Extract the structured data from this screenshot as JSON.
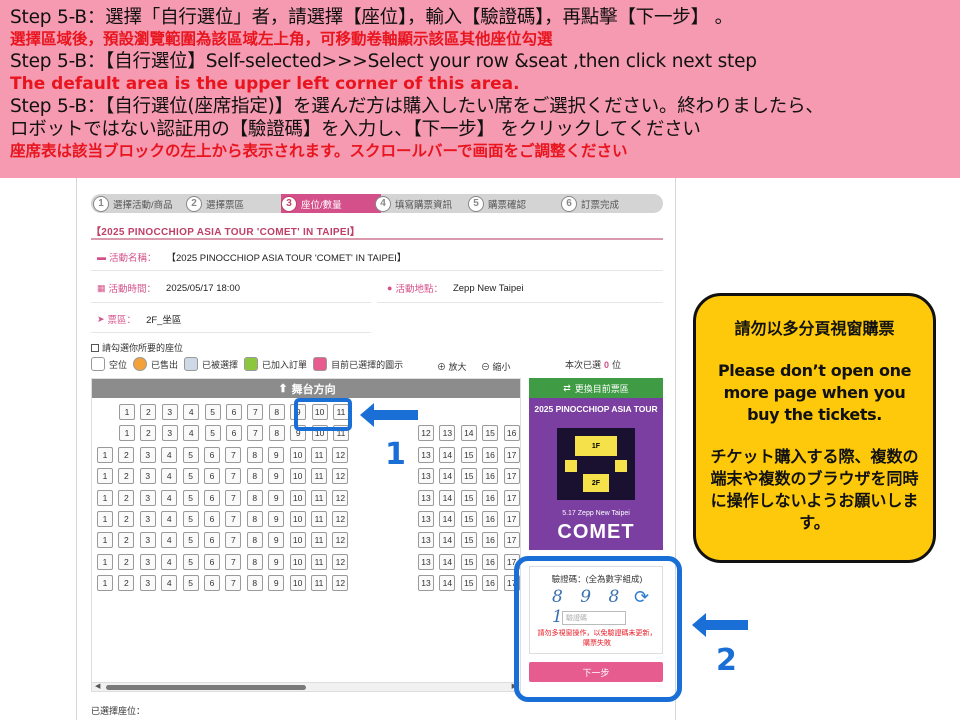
{
  "banner": {
    "line1": "Step 5-B：選擇「自行選位」者，請選擇【座位】，輸入【驗證碼】，再點擊【下一步】 。",
    "line2": "選擇區域後，預設瀏覽範圍為該區域左上角，可移動卷軸顯示該區其他座位勾選",
    "line3": "Step 5-B：【自行選位】Self-selected>>>Select   your row &seat ,then click  next step",
    "line4": "The default area is the upper left corner of this area.",
    "line5": "Step 5-B：【自行選位(座席指定)】を選んだ方は購入したい席をご選択ください。終わりましたら、",
    "line6": "ロボットではない認証用の【驗證碼】を入力し、【下一步】 をクリックしてください",
    "line7": "座席表は該当ブロックの左上から表示されます。スクロールバーで画面をご調整ください"
  },
  "steps": [
    {
      "num": "1",
      "label": "選擇活動/商品"
    },
    {
      "num": "2",
      "label": "選擇票區"
    },
    {
      "num": "3",
      "label": "座位/數量"
    },
    {
      "num": "4",
      "label": "填寫購票資訊"
    },
    {
      "num": "5",
      "label": "購票確認"
    },
    {
      "num": "6",
      "label": "訂票完成"
    }
  ],
  "event": {
    "title": "【2025 PINOCCHIOP ASIA TOUR 'COMET' IN TAIPEI】",
    "name_label": "活動名稱：",
    "name_value": "【2025 PINOCCHIOP ASIA TOUR 'COMET' IN TAIPEI】",
    "time_label": "活動時間：",
    "time_value": "2025/05/17 18:00",
    "venue_label": "活動地點：",
    "venue_value": "Zepp New Taipei",
    "area_label": "票區：",
    "area_value": "2F_坐區"
  },
  "seat_ui": {
    "check_label": "請勾選你所要的座位",
    "legend": [
      "空位",
      "已售出",
      "已被選擇",
      "已加入訂單",
      "目前已選擇的圖示"
    ],
    "zoom_in": "放大",
    "zoom_out": "縮小",
    "count_prefix": "本次已選",
    "count_value": "0",
    "count_suffix": "位",
    "stage": "舞台方向",
    "change_area": "更換目前票區",
    "selected_label": "已選擇座位："
  },
  "seat_rows": [
    {
      "left": [
        "1",
        "2",
        "3",
        "4",
        "5",
        "6",
        "7",
        "8",
        "9",
        "10",
        "11"
      ],
      "right": []
    },
    {
      "left": [
        "1",
        "2",
        "3",
        "4",
        "5",
        "6",
        "7",
        "8",
        "9",
        "10",
        "11"
      ],
      "right": [
        "12",
        "13",
        "14",
        "15",
        "16"
      ]
    },
    {
      "left": [
        "1",
        "2",
        "3",
        "4",
        "5",
        "6",
        "7",
        "8",
        "9",
        "10",
        "11",
        "12"
      ],
      "right": [
        "13",
        "14",
        "15",
        "16",
        "17"
      ]
    },
    {
      "left": [
        "1",
        "2",
        "3",
        "4",
        "5",
        "6",
        "7",
        "8",
        "9",
        "10",
        "11",
        "12"
      ],
      "right": [
        "13",
        "14",
        "15",
        "16",
        "17"
      ]
    },
    {
      "left": [
        "1",
        "2",
        "3",
        "4",
        "5",
        "6",
        "7",
        "8",
        "9",
        "10",
        "11",
        "12"
      ],
      "right": [
        "13",
        "14",
        "15",
        "16",
        "17"
      ]
    },
    {
      "left": [
        "1",
        "2",
        "3",
        "4",
        "5",
        "6",
        "7",
        "8",
        "9",
        "10",
        "11",
        "12"
      ],
      "right": [
        "13",
        "14",
        "15",
        "16",
        "17"
      ]
    },
    {
      "left": [
        "1",
        "2",
        "3",
        "4",
        "5",
        "6",
        "7",
        "8",
        "9",
        "10",
        "11",
        "12"
      ],
      "right": [
        "13",
        "14",
        "15",
        "16",
        "17"
      ]
    },
    {
      "left": [
        "1",
        "2",
        "3",
        "4",
        "5",
        "6",
        "7",
        "8",
        "9",
        "10",
        "11",
        "12"
      ],
      "right": [
        "13",
        "14",
        "15",
        "16",
        "17"
      ]
    },
    {
      "left": [
        "1",
        "2",
        "3",
        "4",
        "5",
        "6",
        "7",
        "8",
        "9",
        "10",
        "11",
        "12"
      ],
      "right": [
        "13",
        "14",
        "15",
        "16",
        "17"
      ]
    }
  ],
  "poster": {
    "title": "2025 PINOCCHIOP ASIA TOUR",
    "floor1": "1F",
    "floor2": "2F",
    "date": "5.17 Zepp New Taipei",
    "logo": "COMET"
  },
  "captcha": {
    "label": "驗證碼：(全為數字組成)",
    "image_text": "8 9 8 1",
    "placeholder": "驗證碼",
    "warning": "請勿多視窗操作，以免驗證碼未更新，購票失敗",
    "next": "下一步"
  },
  "markers": {
    "one": "1",
    "two": "2"
  },
  "notice": {
    "zh": "請勿以多分頁視窗購票",
    "en": "Please don’t open one more page when you buy the tickets.",
    "ja": "チケット購入する際、複数の端末や複数のブラウザを同時に操作しないようお願いします。"
  },
  "colors": {
    "banner_bg": "#f59ab0",
    "accent_pink": "#d4508a",
    "highlight_blue": "#1a6fd6",
    "notice_yellow": "#fdc90a",
    "red_text": "#e8151f"
  }
}
